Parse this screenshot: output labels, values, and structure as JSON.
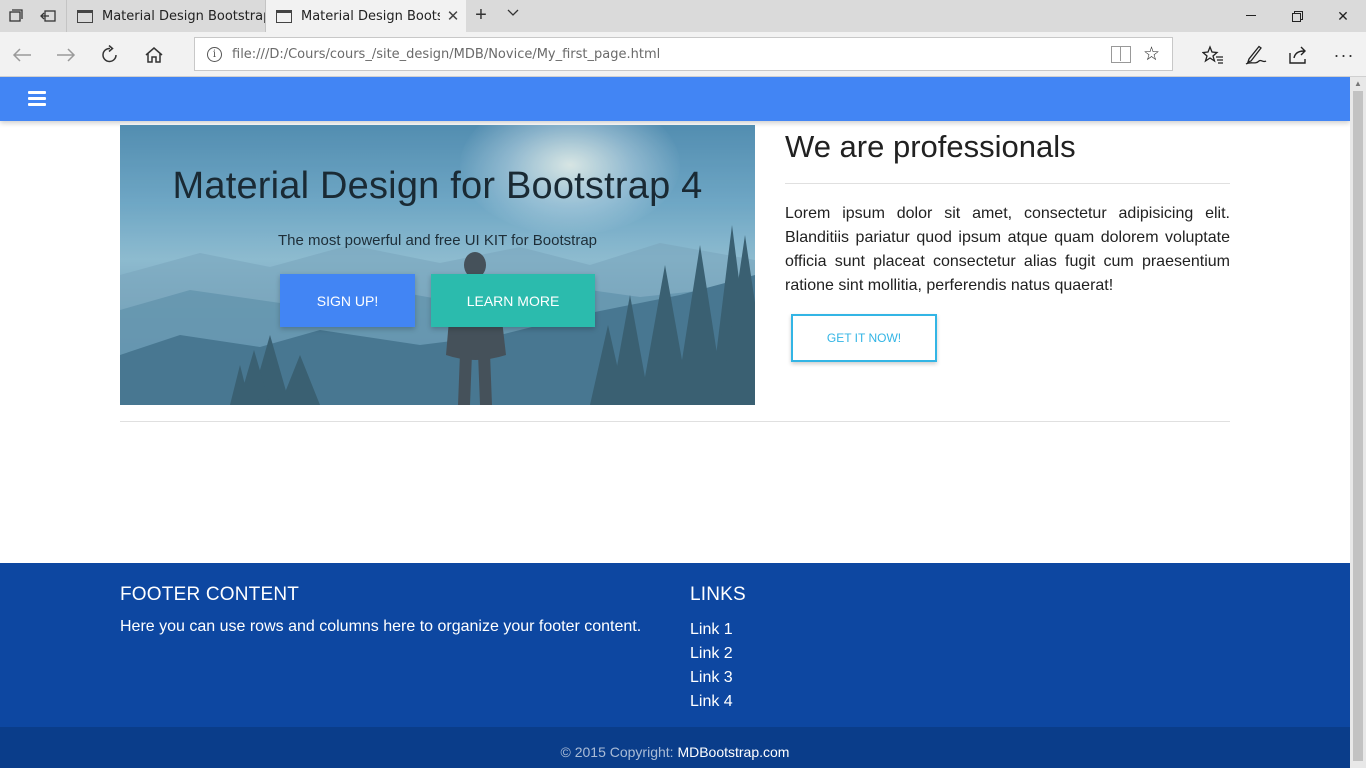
{
  "browser": {
    "tabs": [
      {
        "title": "Material Design Bootstrap",
        "active": false
      },
      {
        "title": "Material Design Bootstr",
        "active": true
      }
    ],
    "address_url": "file:///D:/Cours/cours_/site_design/MDB/Novice/My_first_page.html"
  },
  "hero": {
    "title": "Material Design for Bootstrap 4",
    "subtitle": "The most powerful and free UI KIT for Bootstrap",
    "primary_button": "Sign up!",
    "secondary_button": "Learn more"
  },
  "intro": {
    "heading": "We are professionals",
    "paragraph": "Lorem ipsum dolor sit amet, consectetur adipisicing elit. Blanditiis pariatur quod ipsum atque quam dolorem voluptate officia sunt placeat consectetur alias fugit cum praesentium ratione sint mollitia, perferendis natus quaerat!",
    "cta_button": "Get it now!"
  },
  "footer": {
    "col1_title": "Footer Content",
    "col1_text": "Here you can use rows and columns here to organize your footer content.",
    "col2_title": "Links",
    "links": [
      "Link 1",
      "Link 2",
      "Link 3",
      "Link 4"
    ],
    "copyright_text": "© 2015 Copyright: ",
    "copyright_link": "MDBootstrap.com"
  },
  "colors": {
    "navbar": "#4285f4",
    "primary_button": "#4285f4",
    "teal_button": "#2bbbad",
    "outline_button": "#33b5e5",
    "footer": "#0d47a1",
    "footer_copyright": "#0a3d8a"
  }
}
